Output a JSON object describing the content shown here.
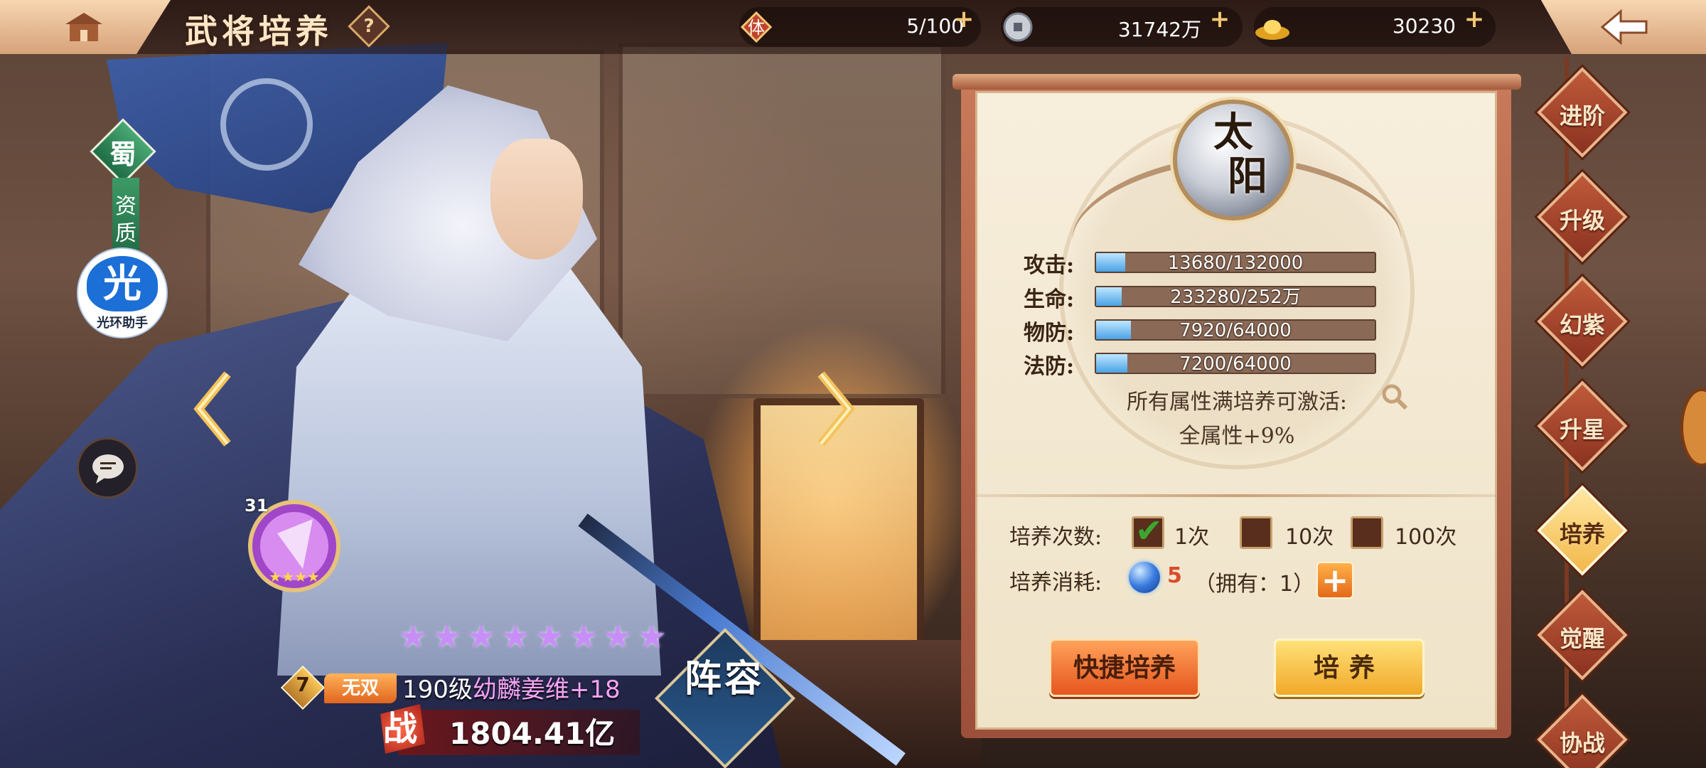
{
  "header": {
    "title": "武将培养",
    "help_label": "?",
    "resources": [
      {
        "icon": "stamina-icon",
        "icon_text": "体",
        "value": "5/100"
      },
      {
        "icon": "silver-coin-icon",
        "value": "31742万"
      },
      {
        "icon": "gold-ingot-icon",
        "value": "30230"
      }
    ]
  },
  "left_panel": {
    "kingdom": "蜀",
    "aptitude_label": "资质",
    "assistant_glyph": "光",
    "assistant_label": "光环助手",
    "pet_level": "31"
  },
  "hero": {
    "stars": 8,
    "rank": "7",
    "tag": "无双",
    "level_text": "190级",
    "name": "幼麟姜维",
    "plus": "+18",
    "power_icon_text": "战",
    "power": "1804.41亿",
    "lineup_label": "阵容"
  },
  "cultivation": {
    "orb_text": "太阳",
    "stats": [
      {
        "label": "攻击:",
        "value": "13680/132000",
        "fill": 0.104
      },
      {
        "label": "生命:",
        "value": "233280/252万",
        "fill": 0.093
      },
      {
        "label": "物防:",
        "value": "7920/64000",
        "fill": 0.124
      },
      {
        "label": "法防:",
        "value": "7200/64000",
        "fill": 0.113
      }
    ],
    "bonus_title": "所有属性满培养可激活:",
    "bonus_value": "全属性+9%",
    "count_label": "培养次数:",
    "count_options": [
      {
        "label": "1次",
        "checked": true
      },
      {
        "label": "10次",
        "checked": false
      },
      {
        "label": "100次",
        "checked": false
      }
    ],
    "cost_label": "培养消耗:",
    "cost_value": "5",
    "own_text": "（拥有：1）",
    "add_label": "+",
    "quick_button": "快捷培养",
    "train_button": "培养"
  },
  "side_menu": [
    {
      "label": "进阶",
      "active": false
    },
    {
      "label": "升级",
      "active": false
    },
    {
      "label": "幻紫",
      "active": false
    },
    {
      "label": "升星",
      "active": false
    },
    {
      "label": "培养",
      "active": true
    },
    {
      "label": "觉醒",
      "active": false
    },
    {
      "label": "协战",
      "active": false
    }
  ],
  "colors": {
    "accent": "#f3b84a",
    "panel_bg": "#f7eedc",
    "stat_fill": "#4aa3e6",
    "cost_red": "#d94a2a"
  }
}
